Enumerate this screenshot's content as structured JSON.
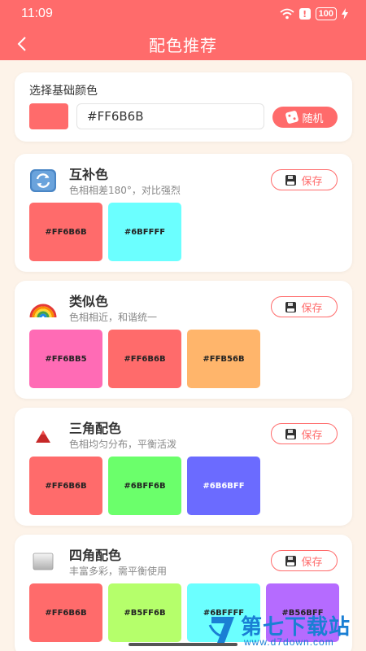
{
  "status_bar": {
    "time": "11:09",
    "battery": "100"
  },
  "header": {
    "title": "配色推荐"
  },
  "base_color": {
    "label": "选择基础颜色",
    "color": "#FF6B6B",
    "hex_value": "#FF6B6B",
    "random_label": "随机"
  },
  "save_label": "保存",
  "schemes": [
    {
      "icon": "refresh-icon",
      "name": "互补色",
      "desc": "色相相差180°，对比强烈",
      "swatches": [
        {
          "hex": "#FF6B6B",
          "label": "#FF6B6B"
        },
        {
          "hex": "#6BFFFF",
          "label": "#6BFFFF"
        }
      ]
    },
    {
      "icon": "rainbow-icon",
      "name": "类似色",
      "desc": "色相相近，和谐统一",
      "swatches": [
        {
          "hex": "#FF6BB5",
          "label": "#FF6BB5"
        },
        {
          "hex": "#FF6B6B",
          "label": "#FF6B6B"
        },
        {
          "hex": "#FFB56B",
          "label": "#FFB56B"
        }
      ]
    },
    {
      "icon": "triangle-icon",
      "name": "三角配色",
      "desc": "色相均匀分布，平衡活泼",
      "swatches": [
        {
          "hex": "#FF6B6B",
          "label": "#FF6B6B"
        },
        {
          "hex": "#6BFF6B",
          "label": "#6BFF6B"
        },
        {
          "hex": "#6B6BFF",
          "label": "#6B6BFF"
        }
      ]
    },
    {
      "icon": "square-icon",
      "name": "四角配色",
      "desc": "丰富多彩，需平衡使用",
      "swatches": [
        {
          "hex": "#FF6B6B",
          "label": "#FF6B6B"
        },
        {
          "hex": "#B5FF6B",
          "label": "#B5FF6B"
        },
        {
          "hex": "#6BFFFF",
          "label": "#6BFFFF"
        },
        {
          "hex": "#B56BFF",
          "label": "#B56BFF"
        }
      ]
    }
  ],
  "watermark": {
    "text": "第七下载站",
    "url": "www.d7down.com"
  }
}
